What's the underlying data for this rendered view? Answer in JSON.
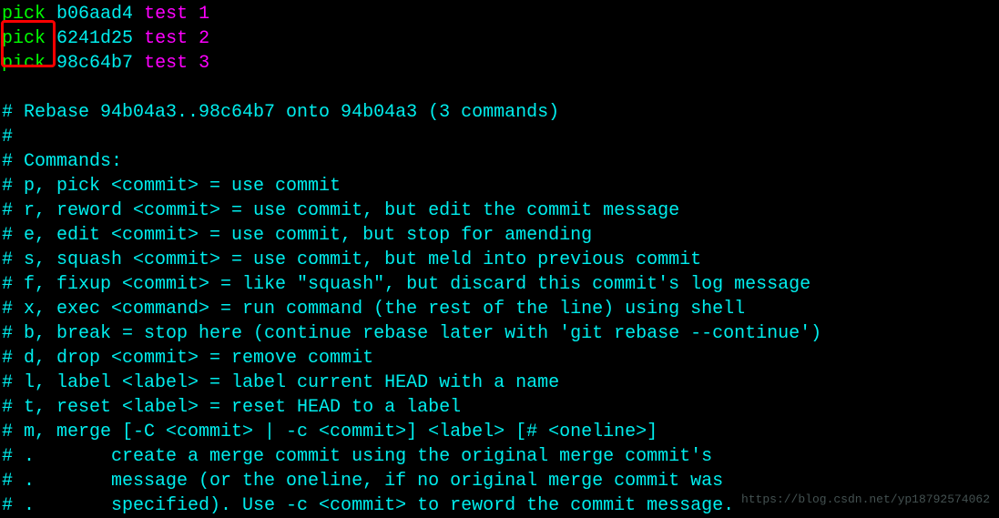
{
  "commits": [
    {
      "action": "pick",
      "hash": "b06aad4",
      "message": "test 1"
    },
    {
      "action": "pick",
      "hash": "6241d25",
      "message": "test 2"
    },
    {
      "action": "pick",
      "hash": "98c64b7",
      "message": "test 3"
    }
  ],
  "comments": {
    "rebase_info": "# Rebase 94b04a3..98c64b7 onto 94b04a3 (3 commands)",
    "hash_only": "#",
    "commands_header": "# Commands:",
    "pick": "# p, pick <commit> = use commit",
    "reword": "# r, reword <commit> = use commit, but edit the commit message",
    "edit": "# e, edit <commit> = use commit, but stop for amending",
    "squash": "# s, squash <commit> = use commit, but meld into previous commit",
    "fixup": "# f, fixup <commit> = like \"squash\", but discard this commit's log message",
    "exec": "# x, exec <command> = run command (the rest of the line) using shell",
    "break": "# b, break = stop here (continue rebase later with 'git rebase --continue')",
    "drop": "# d, drop <commit> = remove commit",
    "label": "# l, label <label> = label current HEAD with a name",
    "reset": "# t, reset <label> = reset HEAD to a label",
    "merge": "# m, merge [-C <commit> | -c <commit>] <label> [# <oneline>]",
    "merge2": "# .       create a merge commit using the original merge commit's",
    "merge3": "# .       message (or the oneline, if no original merge commit was",
    "merge4": "# .       specified). Use -c <commit> to reword the commit message."
  },
  "watermark": "https://blog.csdn.net/yp18792574062"
}
